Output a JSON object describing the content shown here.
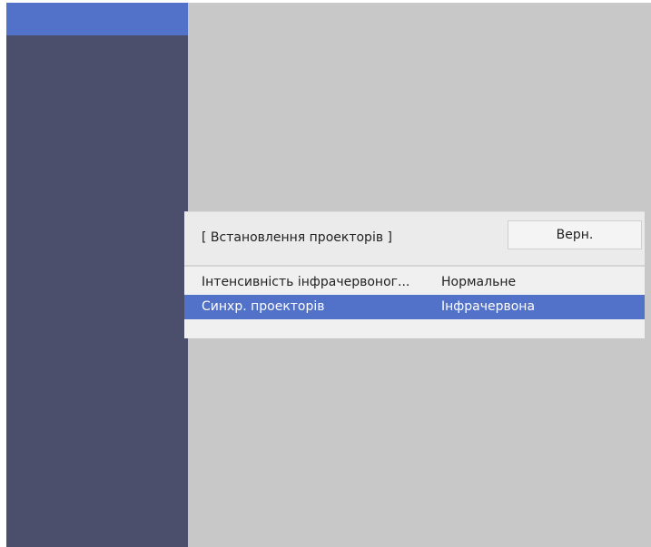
{
  "dialog": {
    "title": "[ Встановлення проекторів ]",
    "back_label": "Верн."
  },
  "settings": [
    {
      "label": "Інтенсивність інфрачервоног...",
      "value": "Нормальне"
    },
    {
      "label": "Синхр. проекторів",
      "value": "Інфрачервона"
    }
  ],
  "colors": {
    "sidebar": "#4b4f6b",
    "selection": "#5271c8",
    "background": "#c8c8c8",
    "dialog": "#f0f0f0"
  }
}
